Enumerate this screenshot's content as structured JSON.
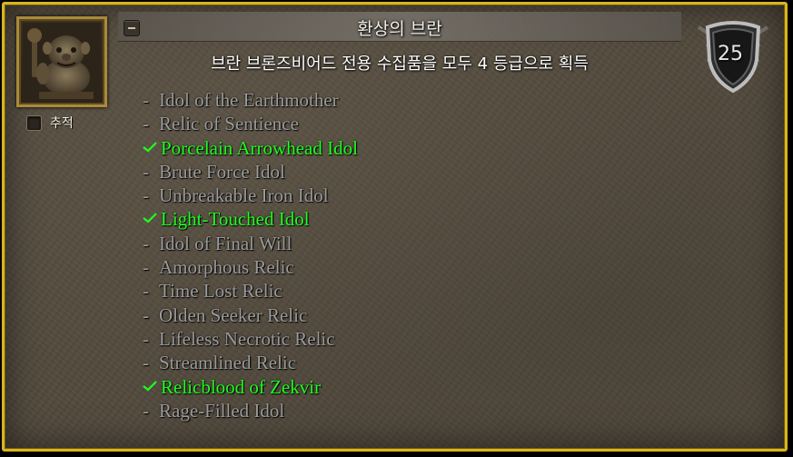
{
  "achievement": {
    "title": "환상의 브란",
    "description": "브란 브론즈비어드 전용 수집품을 모두 4 등급으로 획득",
    "points": "25",
    "track_label": "추적",
    "track_checked": false,
    "icon": "dwarf-statue-icon"
  },
  "criteria": [
    {
      "label": "Idol of the Earthmother",
      "completed": false,
      "prefix": "-"
    },
    {
      "label": "Relic of Sentience",
      "completed": false,
      "prefix": "-"
    },
    {
      "label": "Porcelain Arrowhead Idol",
      "completed": true
    },
    {
      "label": "Brute Force Idol",
      "completed": false,
      "prefix": "-"
    },
    {
      "label": "Unbreakable Iron Idol",
      "completed": false,
      "prefix": "-"
    },
    {
      "label": "Light-Touched Idol",
      "completed": true
    },
    {
      "label": "Idol of Final Will",
      "completed": false,
      "prefix": "-"
    },
    {
      "label": "Amorphous Relic",
      "completed": false,
      "prefix": "-"
    },
    {
      "label": "Time Lost Relic",
      "completed": false,
      "prefix": "-"
    },
    {
      "label": "Olden Seeker Relic",
      "completed": false,
      "prefix": "-"
    },
    {
      "label": "Lifeless Necrotic Relic",
      "completed": false,
      "prefix": "-"
    },
    {
      "label": "Streamlined Relic",
      "completed": false,
      "prefix": "-"
    },
    {
      "label": "Relicblood of Zekvir",
      "completed": true
    },
    {
      "label": "Rage-Filled Idol",
      "completed": false,
      "prefix": "-"
    }
  ],
  "colors": {
    "border": "#d8b51e",
    "completed": "#1fff1f",
    "pending": "#9b9b9b"
  }
}
